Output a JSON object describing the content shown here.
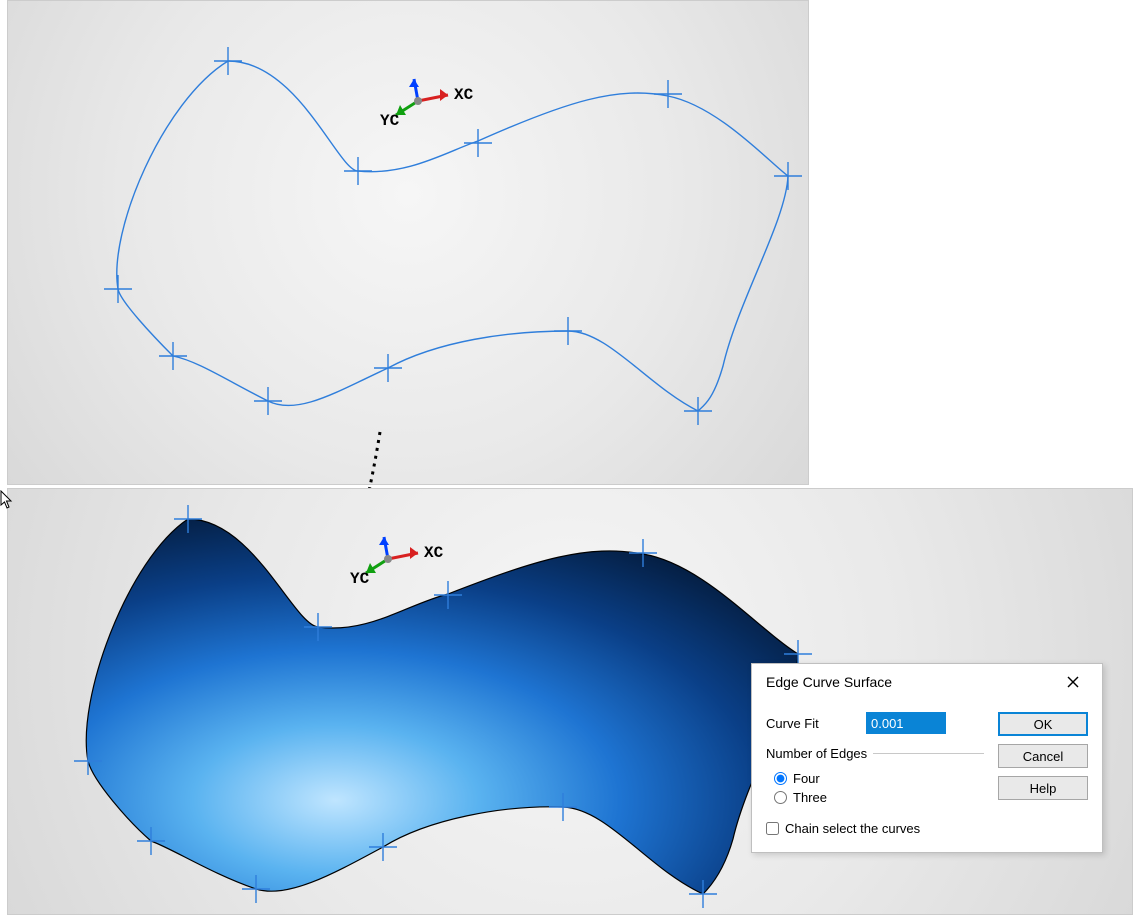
{
  "triad": {
    "x_label": "XC",
    "y_label": "YC"
  },
  "dialog": {
    "title": "Edge Curve Surface",
    "curve_fit_label": "Curve Fit",
    "curve_fit_value": "0.001",
    "num_edges_legend": "Number of Edges",
    "radio_four": "Four",
    "radio_three": "Three",
    "radio_selected": "four",
    "chain_label": "Chain select the curves",
    "chain_checked": false,
    "ok": "OK",
    "cancel": "Cancel",
    "help": "Help"
  }
}
